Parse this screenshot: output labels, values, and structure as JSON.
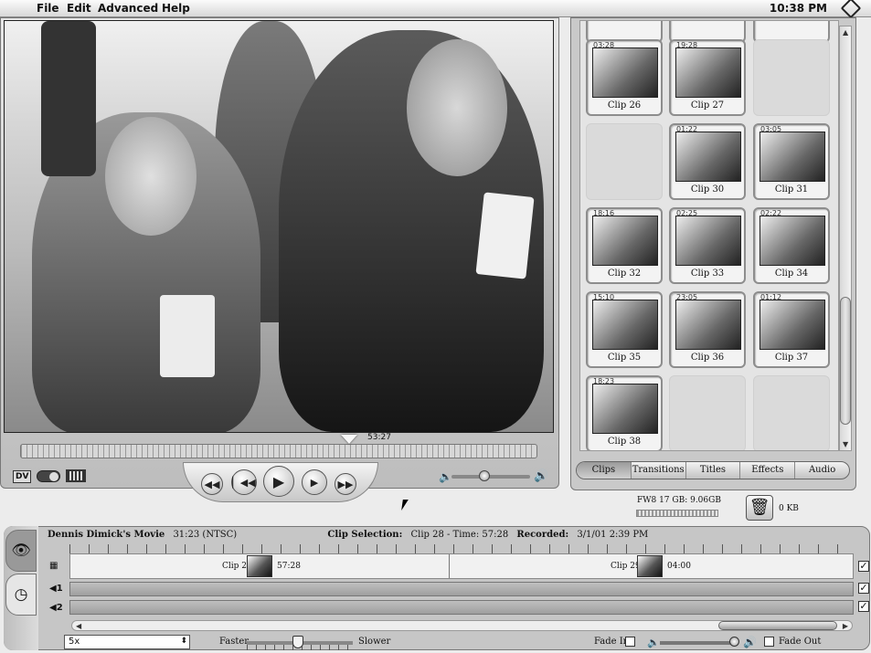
{
  "menubar": {
    "items": [
      "File",
      "Edit",
      "Advanced",
      "Help"
    ],
    "clock": "10:38 PM"
  },
  "monitor": {
    "timecode": "53:27",
    "mode_badge": "DV",
    "transport": [
      "rewind",
      "previous",
      "play",
      "next",
      "fast-forward"
    ]
  },
  "shelf": {
    "clips": [
      {
        "name": "Clip 26",
        "duration": "03:28"
      },
      {
        "name": "Clip 27",
        "duration": "19:28"
      },
      null,
      null,
      {
        "name": "Clip 30",
        "duration": "01:22"
      },
      {
        "name": "Clip 31",
        "duration": "03:05"
      },
      {
        "name": "Clip 32",
        "duration": "18:16"
      },
      {
        "name": "Clip 33",
        "duration": "02:25"
      },
      {
        "name": "Clip 34",
        "duration": "02:22"
      },
      {
        "name": "Clip 35",
        "duration": "15:10"
      },
      {
        "name": "Clip 36",
        "duration": "23:05"
      },
      {
        "name": "Clip 37",
        "duration": "01:12"
      },
      {
        "name": "Clip 38",
        "duration": "18:23"
      },
      null,
      null
    ],
    "tabs": [
      "Clips",
      "Transitions",
      "Titles",
      "Effects",
      "Audio"
    ],
    "selected_tab": "Clips"
  },
  "disk": {
    "label": "FW8 17 GB: 9.06GB",
    "trash_size": "0 KB"
  },
  "timeline": {
    "movie_title": "Dennis Dimick's Movie",
    "movie_time": "31:23 (NTSC)",
    "selection_label": "Clip Selection:",
    "selection_value": "Clip 28 - Time: 57:28",
    "recorded_label": "Recorded:",
    "recorded_value": "3/1/01 2:39 PM",
    "clips": [
      {
        "name": "Clip 28",
        "duration": "57:28"
      },
      {
        "name": "Clip 29",
        "duration": "04:00"
      }
    ],
    "audio_tracks": [
      "1",
      "2"
    ],
    "zoom": "5x",
    "faster_label": "Faster",
    "slower_label": "Slower",
    "fade_in_label": "Fade In",
    "fade_out_label": "Fade Out"
  }
}
